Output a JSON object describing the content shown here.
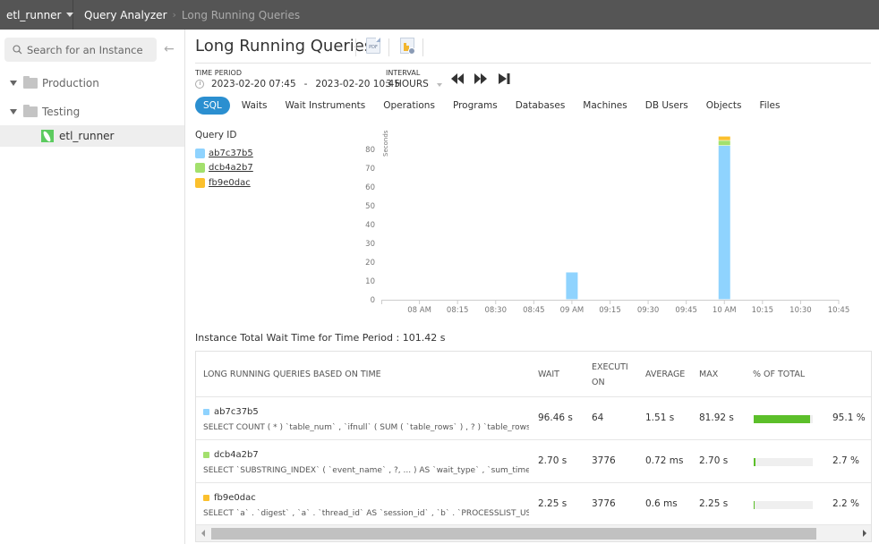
{
  "topbar": {
    "instance": "etl_runner",
    "breadcrumb": [
      {
        "label": "Query Analyzer"
      },
      {
        "label": "Long Running Queries"
      }
    ]
  },
  "sidebar": {
    "search_placeholder": "Search for an Instance",
    "groups": [
      {
        "label": "Production"
      },
      {
        "label": "Testing"
      }
    ],
    "instances": [
      {
        "label": "etl_runner",
        "selected": true
      }
    ]
  },
  "main": {
    "title": "Long Running Queries",
    "export_pdf_label": "PDF",
    "time_period": {
      "label": "TIME PERIOD",
      "from": "2023-02-20 07:45",
      "separator": "-",
      "to": "2023-02-20 10:45"
    },
    "interval": {
      "label": "INTERVAL",
      "value": "3 HOURS"
    },
    "tabs": [
      {
        "label": "SQL",
        "active": true
      },
      {
        "label": "Waits"
      },
      {
        "label": "Wait Instruments"
      },
      {
        "label": "Operations"
      },
      {
        "label": "Programs"
      },
      {
        "label": "Databases"
      },
      {
        "label": "Machines"
      },
      {
        "label": "DB Users"
      },
      {
        "label": "Objects"
      },
      {
        "label": "Files"
      }
    ],
    "legend": {
      "title": "Query ID"
    },
    "total_wait": "Instance Total Wait Time for Time Period : 101.42 s",
    "table": {
      "headers": {
        "query": "LONG RUNNING QUERIES BASED ON TIME",
        "wait": "WAIT",
        "execution": "EXECUTION",
        "average": "AVERAGE",
        "max": "MAX",
        "pct": "% OF TOTAL"
      },
      "rows": [
        {
          "id": "ab7c37b5",
          "color": "#8fd3fe",
          "sql": "SELECT COUNT ( * ) `table_num` , `ifnull` ( SUM ( `table_rows` ) , ? ) `table_rows_num` ,...",
          "wait": "96.46 s",
          "execution": "64",
          "average": "1.51 s",
          "max": "81.92 s",
          "pct_value": 95.1,
          "pct": "95.1 %"
        },
        {
          "id": "dcb4a2b7",
          "color": "#a3e06d",
          "sql": "SELECT `SUBSTRING_INDEX` ( `event_name` , ?, ... ) AS `wait_type` , `sum_timer_wait` /...",
          "wait": "2.70 s",
          "execution": "3776",
          "average": "0.72 ms",
          "max": "2.70 s",
          "pct_value": 2.7,
          "pct": "2.7 %"
        },
        {
          "id": "fb9e0dac",
          "color": "#fbc02d",
          "sql": "SELECT `a` . `digest` , `a` . `thread_id` AS `session_id` , `b` . `PROCESSLIST_USER` AS `db...",
          "wait": "2.25 s",
          "execution": "3776",
          "average": "0.6 ms",
          "max": "2.25 s",
          "pct_value": 2.2,
          "pct": "2.2 %"
        }
      ]
    }
  },
  "chart_data": {
    "type": "bar",
    "stacked": true,
    "title": "",
    "xlabel": "",
    "ylabel": "Seconds",
    "ylim": [
      0,
      85
    ],
    "yticks": [
      0,
      10,
      20,
      30,
      40,
      50,
      60,
      70,
      80
    ],
    "x_range": [
      "07:45",
      "10:45"
    ],
    "x_ticks": [
      "08 AM",
      "08:15",
      "08:30",
      "08:45",
      "09 AM",
      "09:15",
      "09:30",
      "09:45",
      "10 AM",
      "10:15",
      "10:30",
      "10:45"
    ],
    "categories": [
      "09 AM",
      "10 AM"
    ],
    "series": [
      {
        "name": "ab7c37b5",
        "color": "#8fd3fe",
        "values": [
          14.54,
          81.92
        ]
      },
      {
        "name": "dcb4a2b7",
        "color": "#a3e06d",
        "values": [
          0,
          2.7
        ]
      },
      {
        "name": "fb9e0dac",
        "color": "#fbc02d",
        "values": [
          0,
          2.25
        ]
      }
    ],
    "legend": "top-left",
    "grid": false
  }
}
